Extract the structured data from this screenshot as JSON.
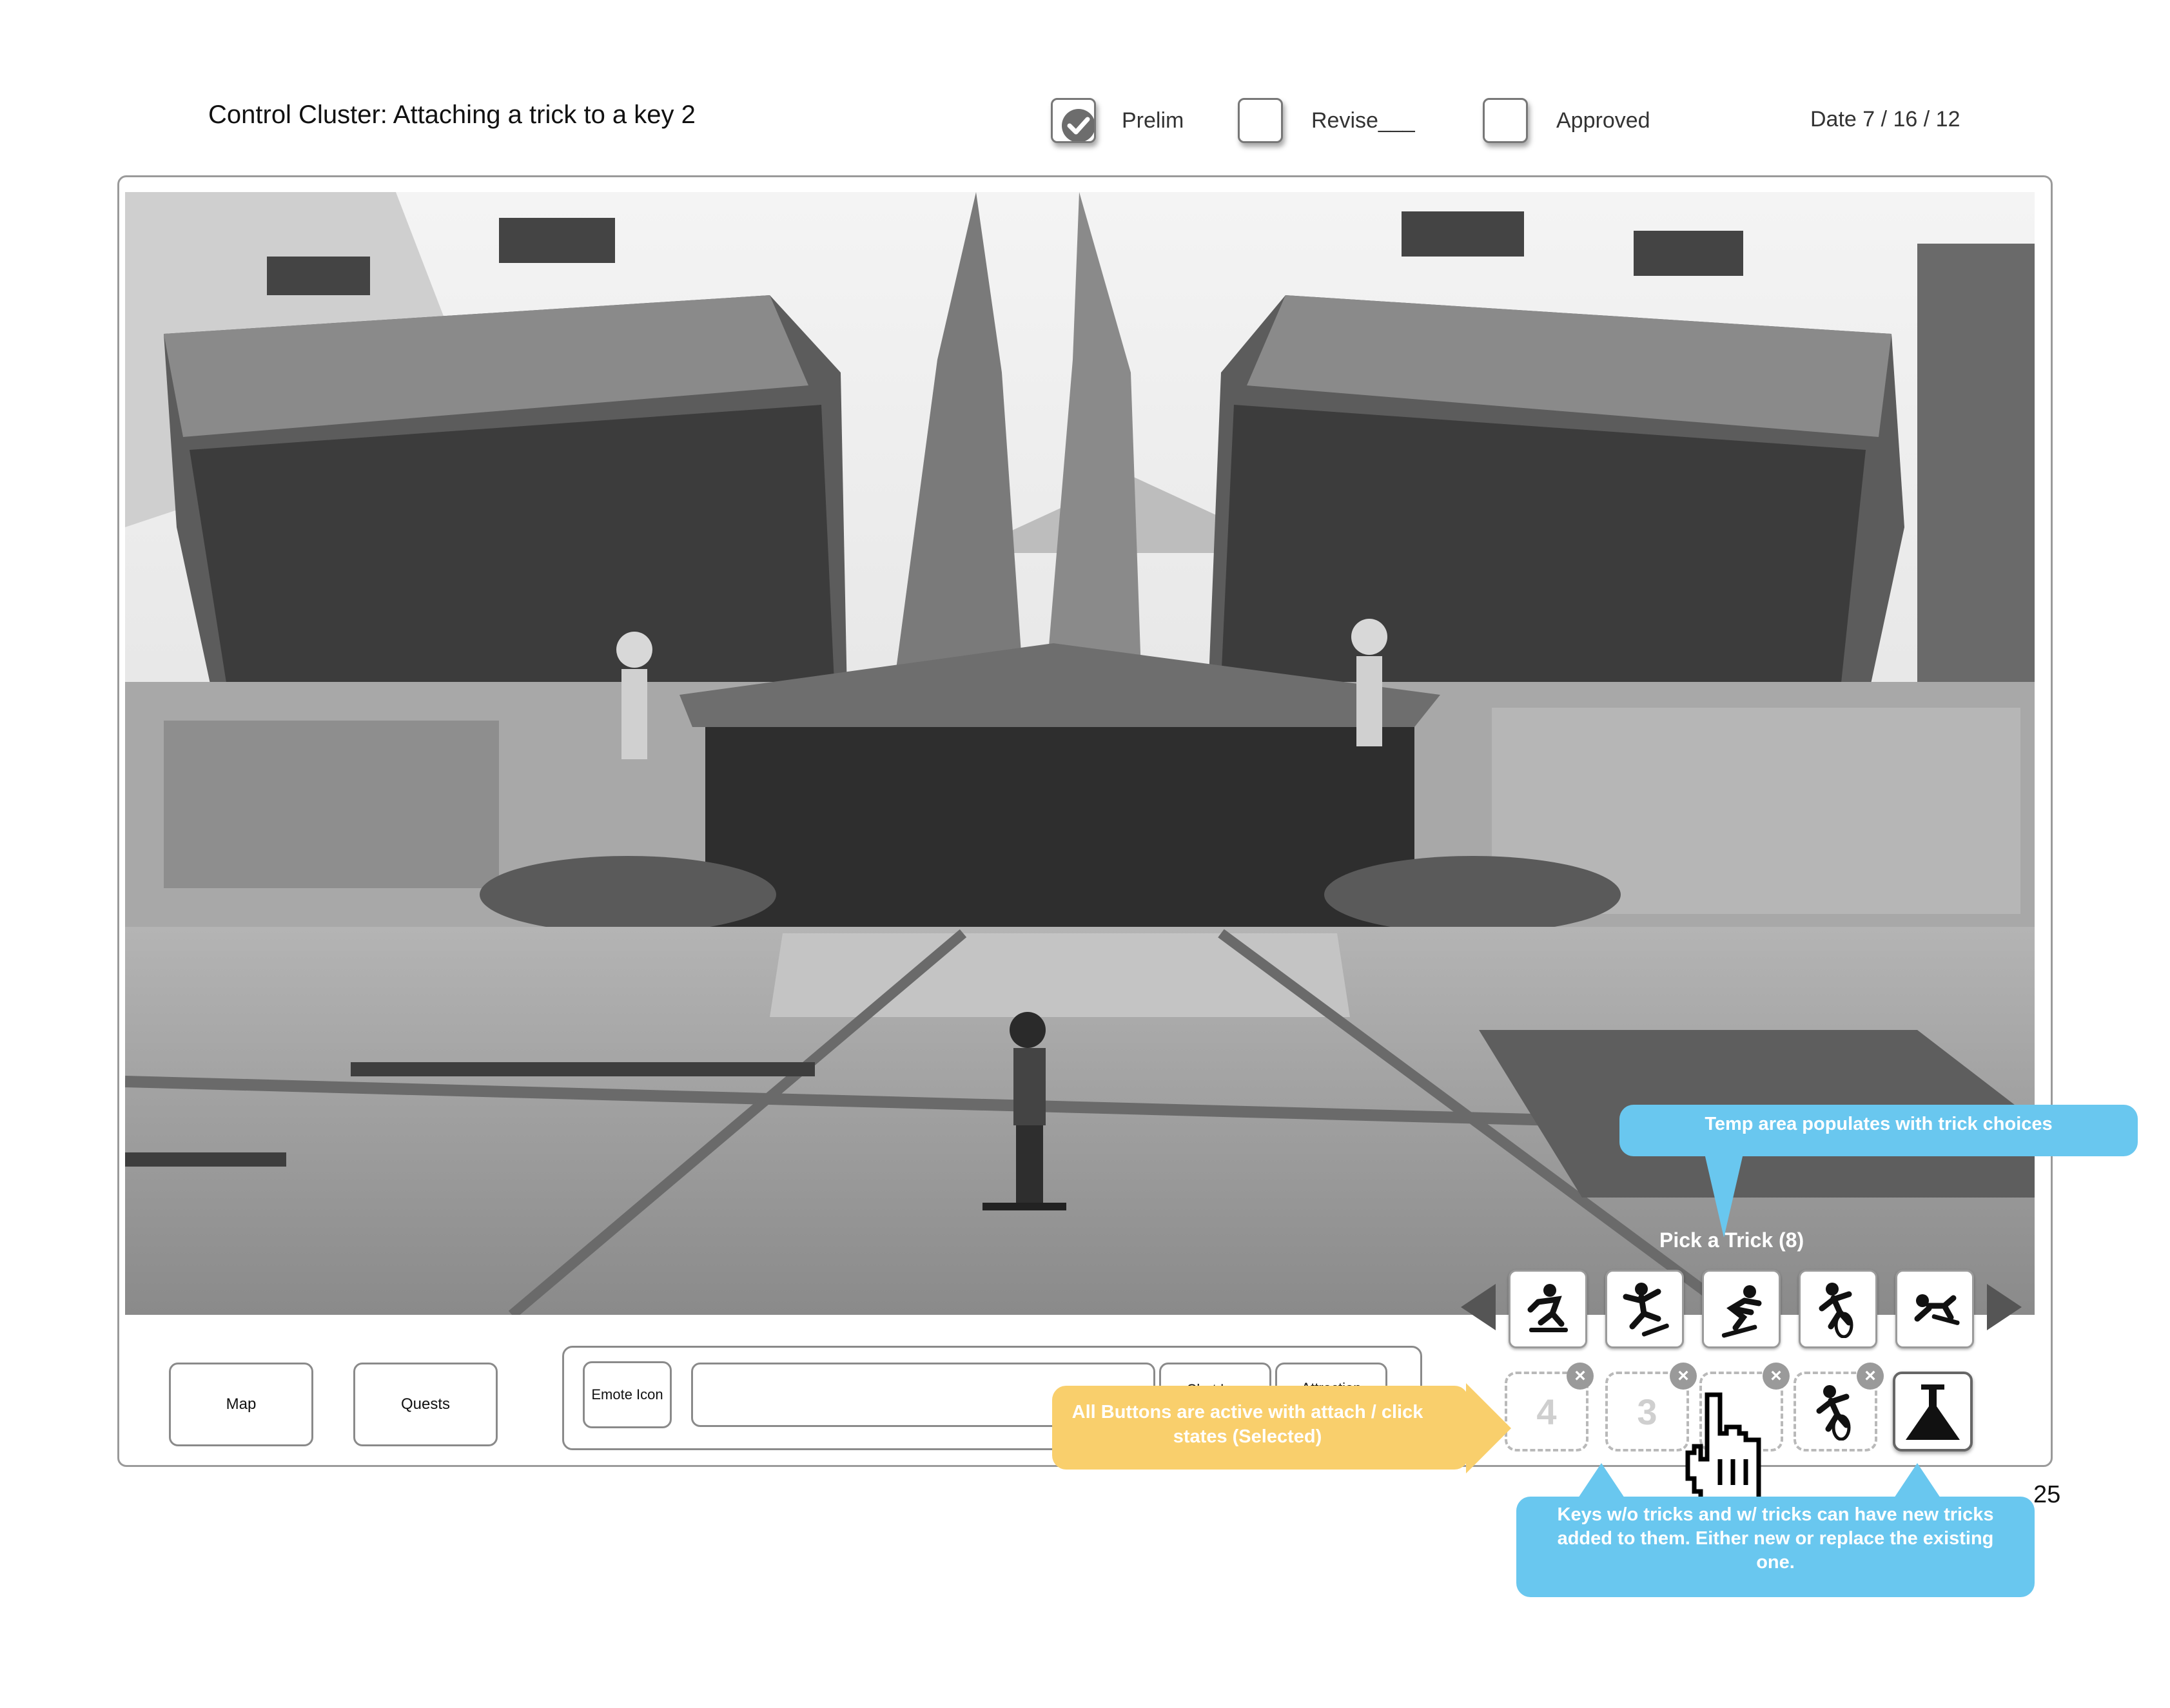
{
  "header": {
    "title": "Control Cluster: Attaching a trick to a key 2",
    "statuses": [
      {
        "label": "Prelim",
        "checked": true
      },
      {
        "label": "Revise___",
        "checked": false
      },
      {
        "label": "Approved",
        "checked": false
      }
    ],
    "date": "Date 7 / 16 / 12"
  },
  "hud": {
    "map_label": "Map",
    "quests_label": "Quests",
    "emote_label": "Emote Icon",
    "chat_input_value": "",
    "chat_log_label": "Chat Log",
    "attraction_label": "Attraction"
  },
  "trick_picker": {
    "title": "Pick a Trick (8)",
    "tricks": [
      "trick-1",
      "trick-2",
      "trick-3",
      "trick-4",
      "trick-5"
    ]
  },
  "keys": [
    {
      "label": "4",
      "has_trick": false
    },
    {
      "label": "3",
      "has_trick": false
    },
    {
      "label": "",
      "has_trick": false
    },
    {
      "label": "",
      "has_trick": true
    },
    {
      "label": "",
      "has_trick": true,
      "selected": true
    }
  ],
  "callouts": {
    "temp_area": "Temp area populates with trick choices",
    "buttons_active": "All Buttons are active with attach / click states (Selected)",
    "keys_info": "Keys w/o tricks and w/ tricks can have new tricks added to them. Either new or replace the existing one."
  },
  "page_number": "25",
  "colors": {
    "callout_blue": "#69c7ef",
    "callout_yellow": "#f9cf6c"
  }
}
